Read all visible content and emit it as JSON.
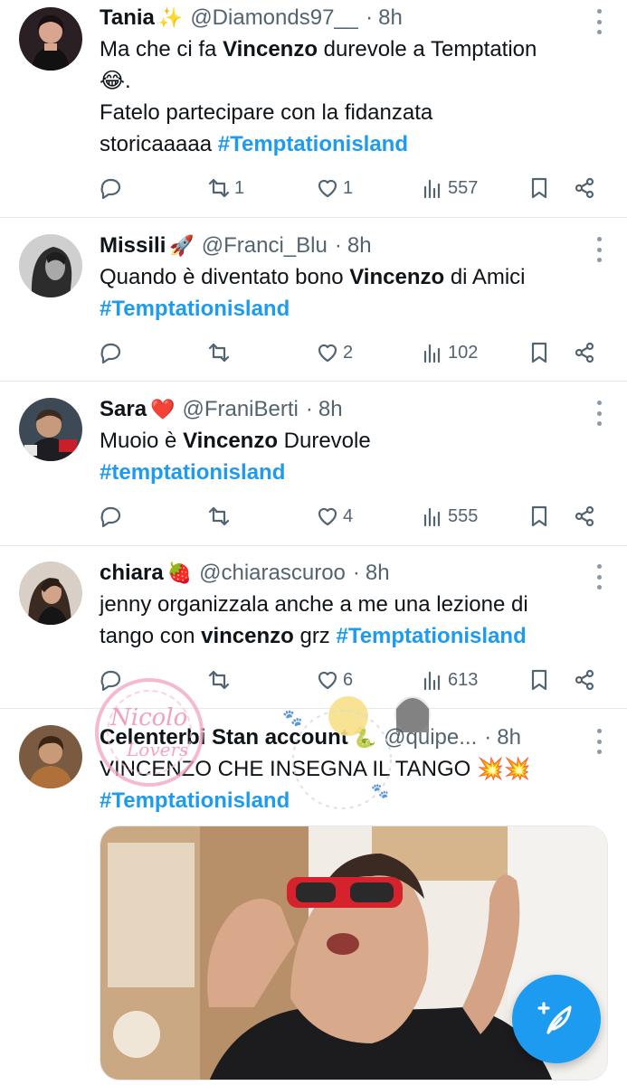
{
  "colors": {
    "accent": "#1d9bf0",
    "muted": "#536471",
    "text": "#0f1419"
  },
  "tweets": [
    {
      "name": "Tania",
      "emoji": "✨",
      "handle": "@Diamonds97__",
      "sep": "·",
      "time": "8h",
      "text": {
        "p1": "Ma che ci fa ",
        "bold": "Vincenzo",
        "p2": " durevole a Temptation",
        "laugh": "😂",
        "dot": ".",
        "line3": "Fatelo partecipare con la fidanzata",
        "line4": "storicaaaaa  ",
        "tag": "#Temptationisland"
      },
      "stats": {
        "replies": "",
        "reposts": "1",
        "likes": "1",
        "views": "557"
      }
    },
    {
      "name": "Missili",
      "emoji": "🚀",
      "handle": "@Franci_Blu",
      "sep": "·",
      "time": "8h",
      "text": {
        "p1": "Quando è diventato bono ",
        "bold": "Vincenzo",
        "p2": " di Amici",
        "tag": "#Temptationisland"
      },
      "stats": {
        "replies": "",
        "reposts": "",
        "likes": "2",
        "views": "102"
      }
    },
    {
      "name": "Sara",
      "emoji": "❤️",
      "handle": "@FraniBerti",
      "sep": "·",
      "time": "8h",
      "text": {
        "p1": "Muoio è ",
        "bold": "Vincenzo",
        "p2": " Durevole",
        "tag": "#temptationisland"
      },
      "stats": {
        "replies": "",
        "reposts": "",
        "likes": "4",
        "views": "555"
      }
    },
    {
      "name": "chiara",
      "emoji": "🍓",
      "handle": "@chiarascuroo",
      "sep": "·",
      "time": "8h",
      "text": {
        "p1": "jenny organizzala anche a me una lezione di",
        "p2": "tango con ",
        "bold": "vincenzo",
        "p3": " grz  ",
        "tag": "#Temptationisland"
      },
      "stats": {
        "replies": "",
        "reposts": "",
        "likes": "6",
        "views": "613"
      }
    },
    {
      "name": "Celenterbi Stan account",
      "emoji": "🐍",
      "handle": "@quipe...",
      "sep": "·",
      "time": "8h",
      "text": {
        "p1": "VINCENZO CHE INSEGNA IL TANGO ",
        "emoji": "💥💥",
        "tag": "#Temptationisland"
      }
    }
  ],
  "watermark": {
    "text": "Nicolo Lovers"
  },
  "icons": [
    "reply-icon",
    "repost-icon",
    "like-icon",
    "views-icon",
    "bookmark-icon",
    "share-icon",
    "more-icon",
    "compose-icon"
  ]
}
